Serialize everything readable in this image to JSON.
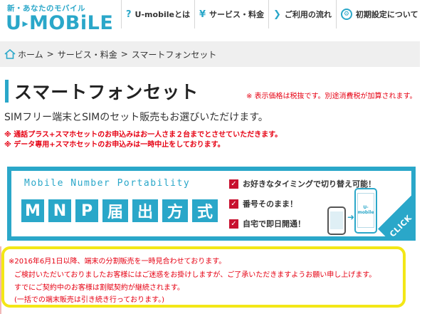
{
  "header": {
    "logo_tagline": "新・あなたのモバイル",
    "logo_text_u": "U",
    "logo_text_mobile": "MOBiLE",
    "nav": [
      {
        "icon": "?",
        "label": "U-mobileとは"
      },
      {
        "icon": "¥",
        "label": "サービス・料金"
      },
      {
        "icon": "❯",
        "label": "ご利用の流れ"
      },
      {
        "icon": "⚙",
        "label": "初期設定について"
      }
    ]
  },
  "breadcrumb": {
    "home": "ホーム",
    "sep": ">",
    "level2": "サービス・料金",
    "current": "スマートフォンセット"
  },
  "page": {
    "title": "スマートフォンセット",
    "tax_note": "※ 表示価格は税抜です。別途消費税が加算されます。",
    "lead": "SIMフリー端末とSIMのセット販売もお選びいただけます。",
    "warning_1": "※ 通話プラス+スマホセットのお申込みはお一人さま２台までとさせていただきます。",
    "warning_2": "※ データ専用+スマホセットのお申込みは一時中止をしております。"
  },
  "banner": {
    "subtitle": "Mobile Number Portability",
    "title_chars": [
      "M",
      "N",
      "P",
      "届",
      "出",
      "方",
      "式"
    ],
    "checks": [
      "お好きなタイミングで切り替え可能！",
      "番号そのまま！",
      "自宅で即日開通！"
    ],
    "check_mark": "✓",
    "phone_label": "U-mobile",
    "click": "CLICK"
  },
  "notice": {
    "line1": "※2016年6月1日以降、端末の分割販売を一時見合わせております。",
    "line2": "ご検討いただいておりましたお客様にはご迷惑をお掛けしますが、ご了承いただきますようお願い申し上げます。",
    "line3": "すでにご契約中のお客様は割賦契約が継続されます。",
    "line4": "(一括での端末販売は引き続き行っております。)"
  },
  "colors": {
    "brand": "#2aa7c9",
    "alert": "#e60012",
    "highlight_border": "#f3e716"
  }
}
